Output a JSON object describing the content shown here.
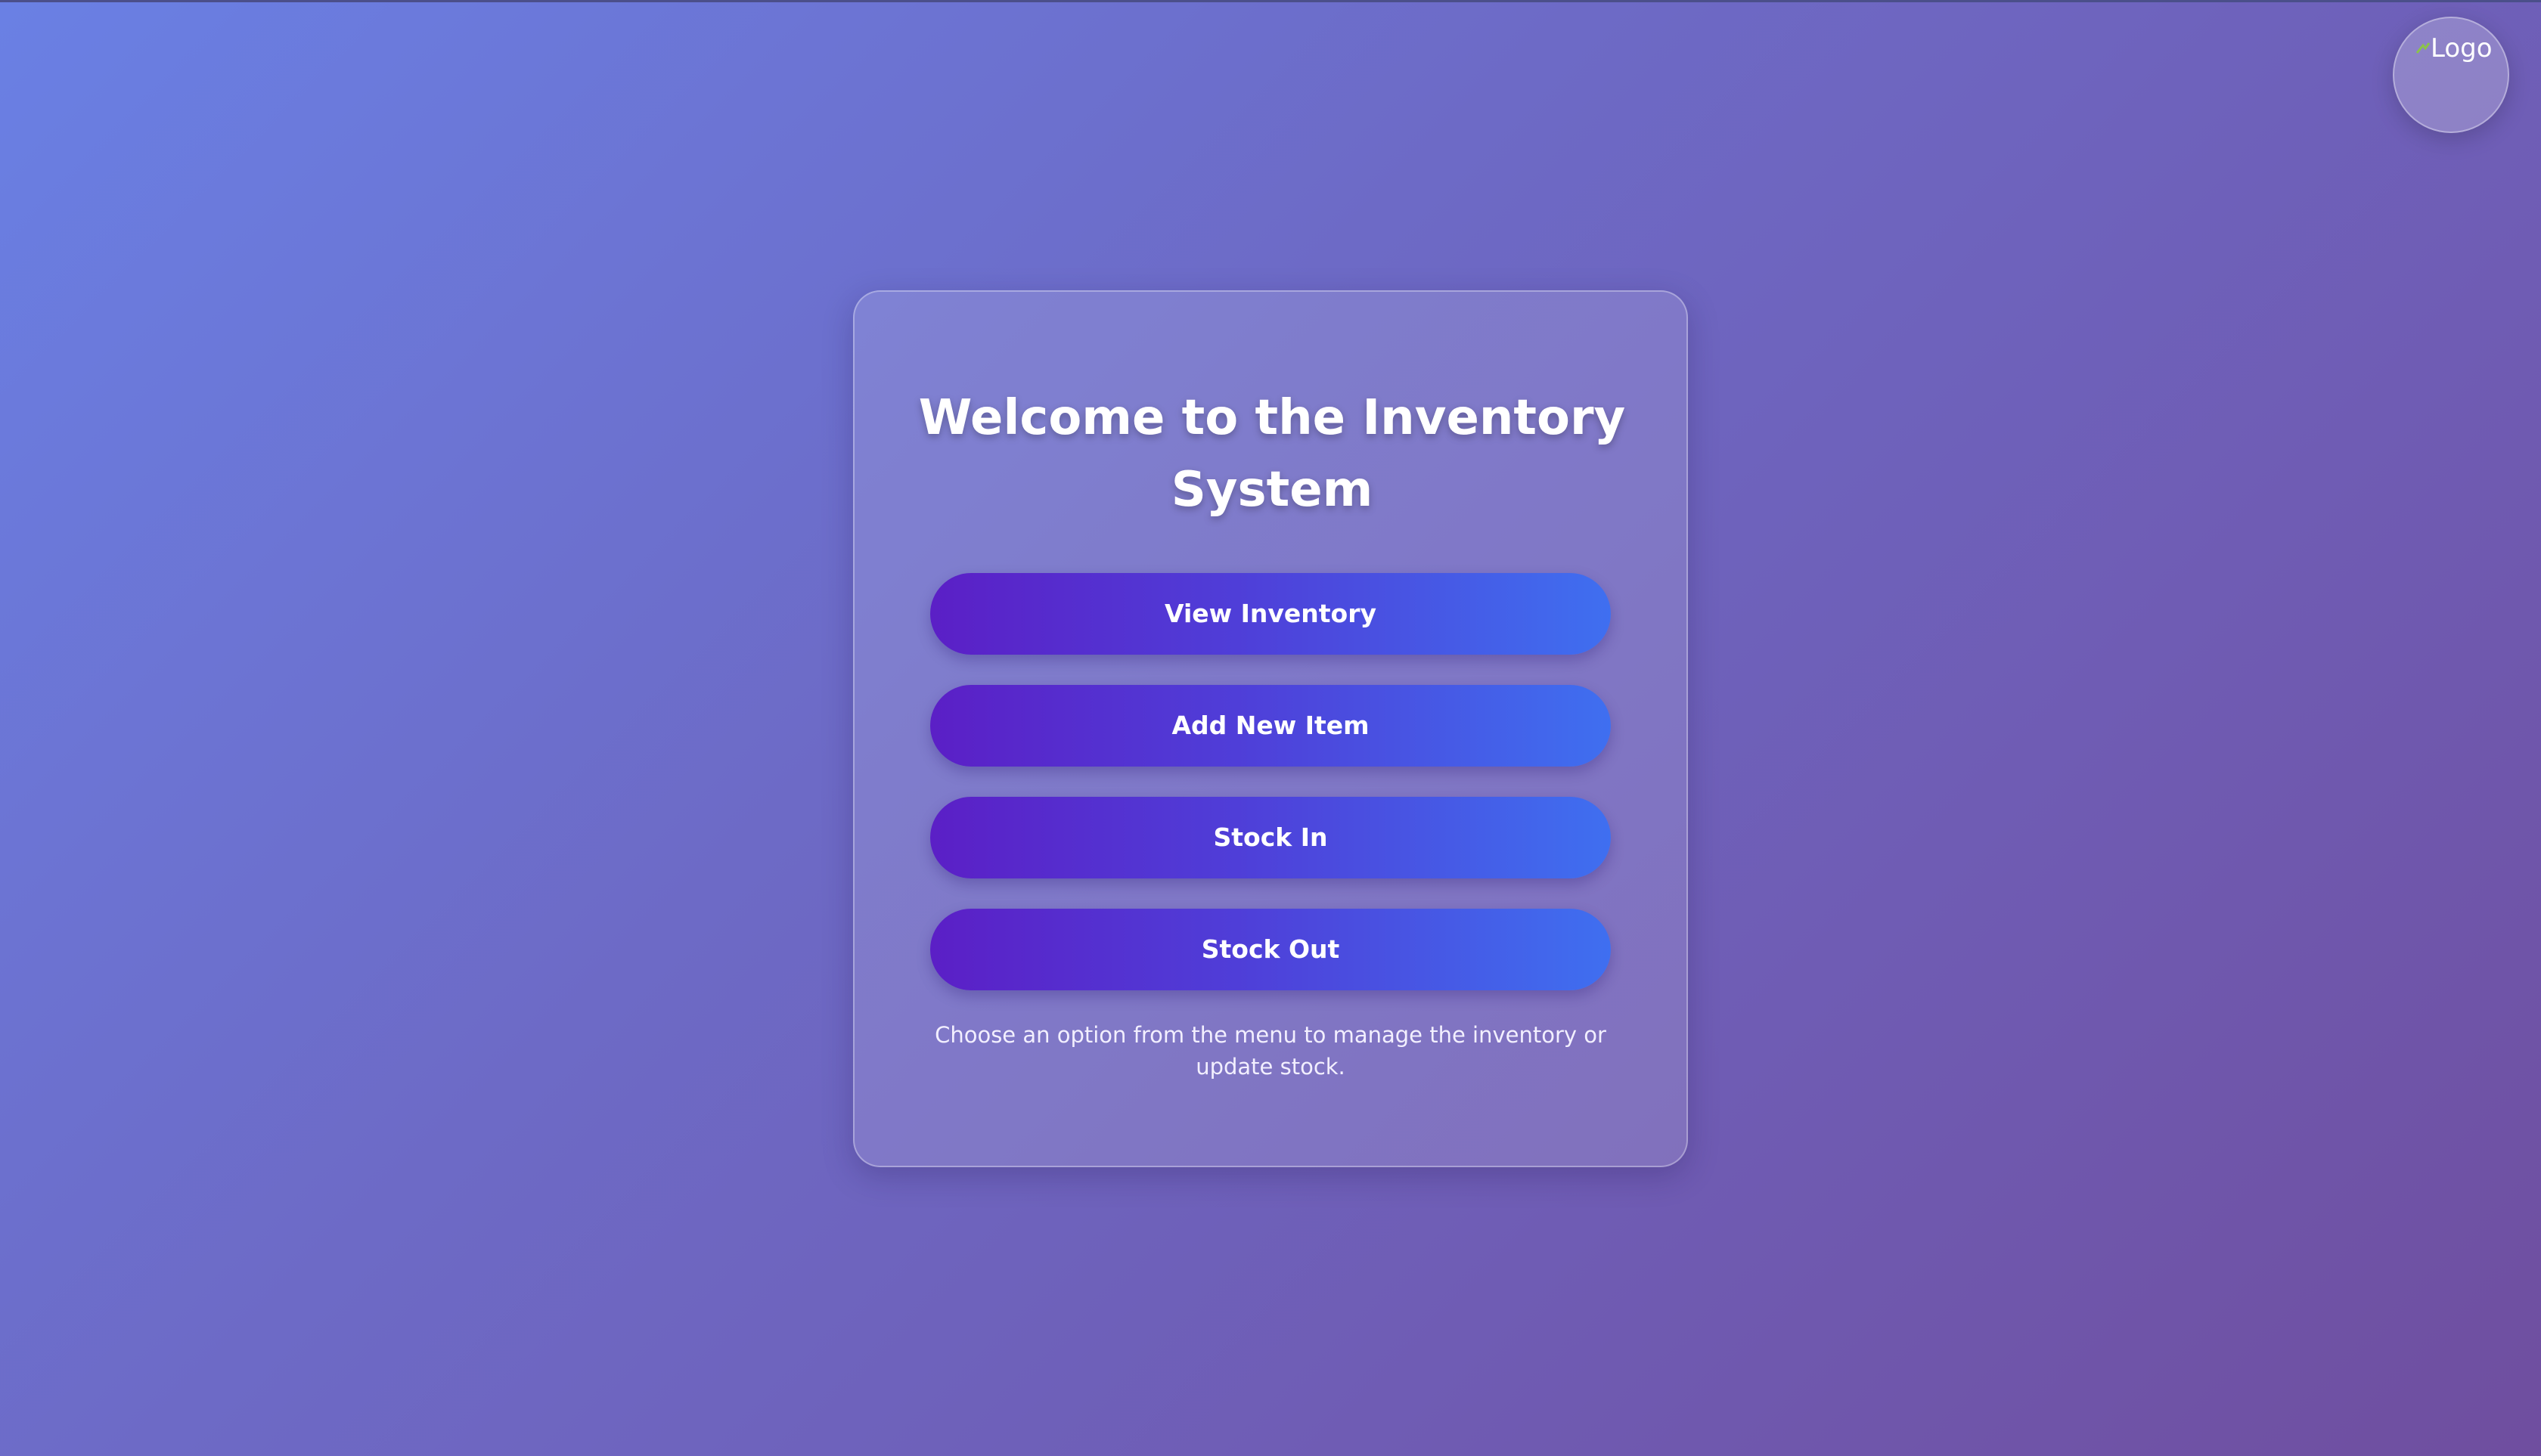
{
  "header": {
    "logo_alt": "Logo"
  },
  "main": {
    "title": "Welcome to the Inventory System",
    "buttons": [
      {
        "label": "View Inventory"
      },
      {
        "label": "Add New Item"
      },
      {
        "label": "Stock In"
      },
      {
        "label": "Stock Out"
      }
    ],
    "description": "Choose an option from the menu to manage the inventory or update stock."
  },
  "colors": {
    "background_start": "#6a80e4",
    "background_end": "#6f4e9f",
    "button_start": "#5b1fc6",
    "button_end": "#3f6ff0"
  }
}
